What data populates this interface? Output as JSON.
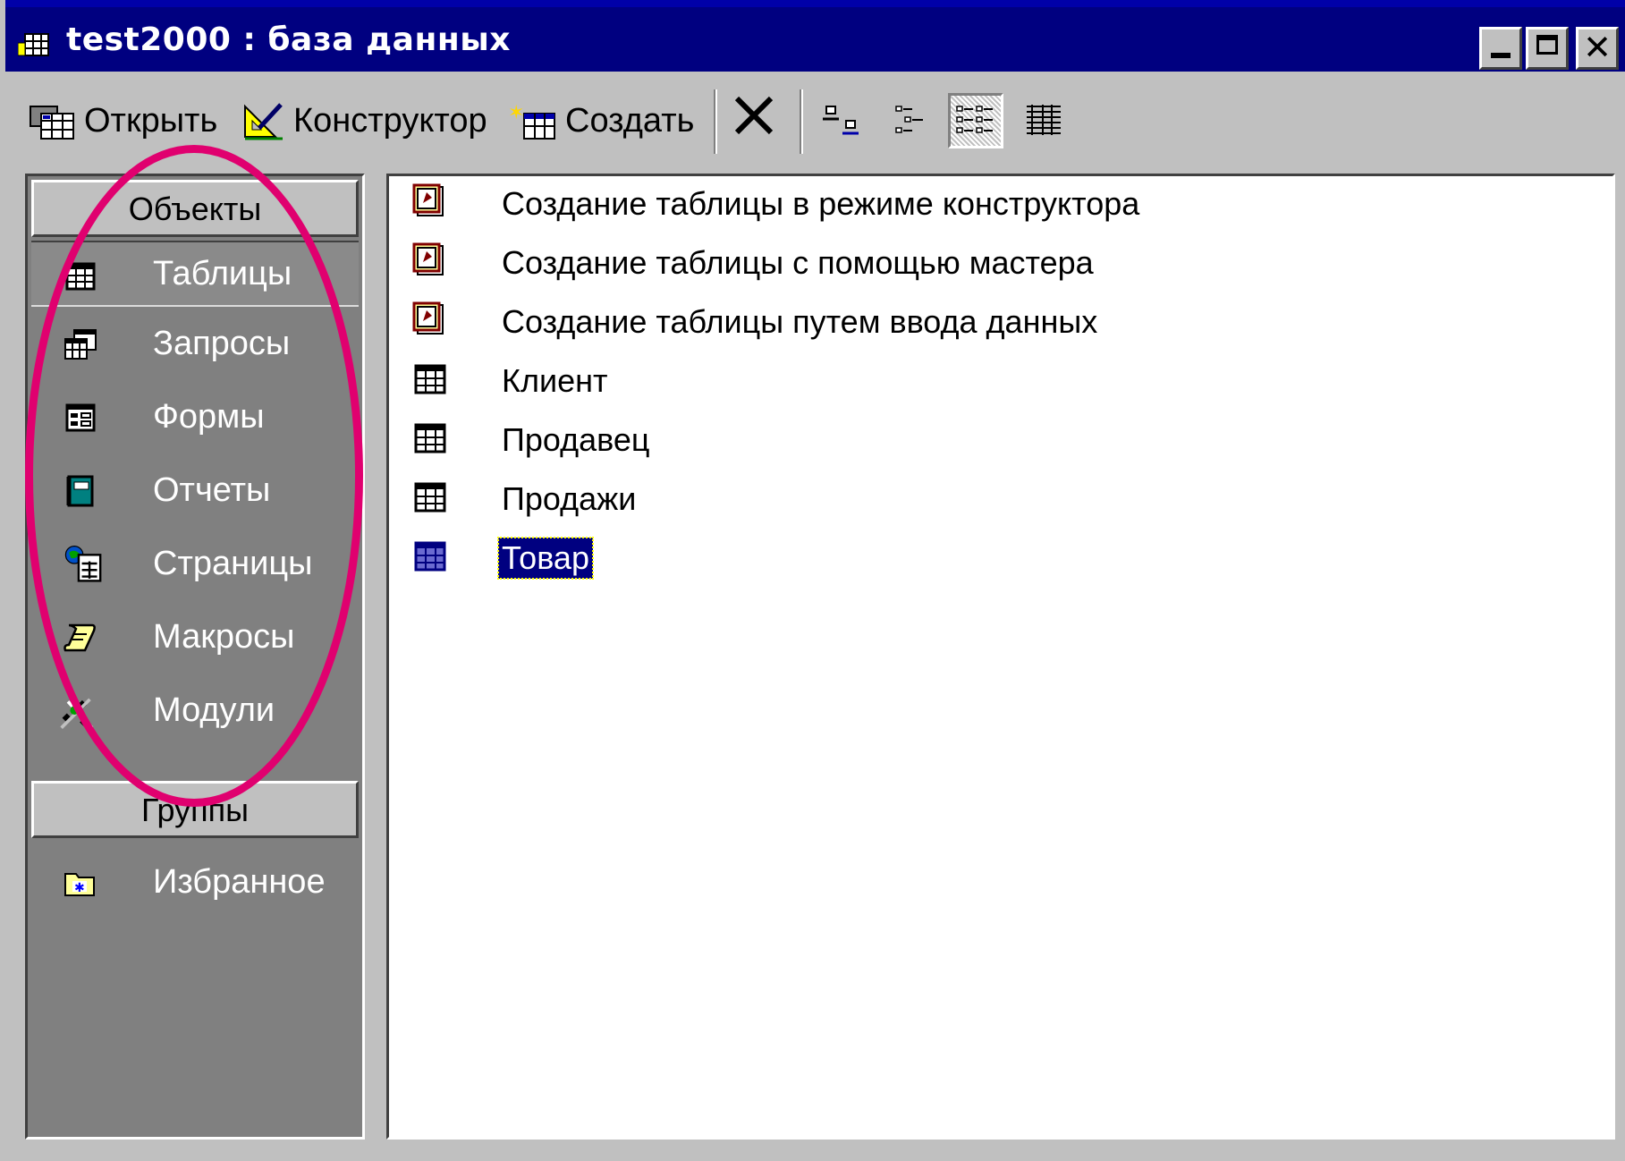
{
  "window": {
    "title": "test2000 : база данных"
  },
  "toolbar": {
    "open_label": "Открыть",
    "design_label": "Конструктор",
    "create_label": "Создать"
  },
  "sidebar": {
    "objects_header": "Объекты",
    "items": [
      {
        "label": "Таблицы",
        "icon": "table-icon"
      },
      {
        "label": "Запросы",
        "icon": "query-icon"
      },
      {
        "label": "Формы",
        "icon": "form-icon"
      },
      {
        "label": "Отчеты",
        "icon": "report-icon"
      },
      {
        "label": "Страницы",
        "icon": "page-icon"
      },
      {
        "label": "Макросы",
        "icon": "macro-icon"
      },
      {
        "label": "Модули",
        "icon": "module-icon"
      }
    ],
    "groups_header": "Группы",
    "groups": [
      {
        "label": "Избранное",
        "icon": "favorites-folder-icon"
      }
    ]
  },
  "list": {
    "items": [
      {
        "label": "Создание таблицы в режиме конструктора",
        "icon": "wizard-shortcut-icon"
      },
      {
        "label": "Создание таблицы с помощью мастера",
        "icon": "wizard-shortcut-icon"
      },
      {
        "label": "Создание таблицы путем ввода данных",
        "icon": "wizard-shortcut-icon"
      },
      {
        "label": "Клиент",
        "icon": "table-icon"
      },
      {
        "label": "Продавец",
        "icon": "table-icon"
      },
      {
        "label": "Продажи",
        "icon": "table-icon"
      },
      {
        "label": "Товар",
        "icon": "table-icon",
        "selected": true
      }
    ]
  },
  "colors": {
    "titlebar": "#000080",
    "annotation": "#e0006f",
    "background": "#00008b"
  }
}
